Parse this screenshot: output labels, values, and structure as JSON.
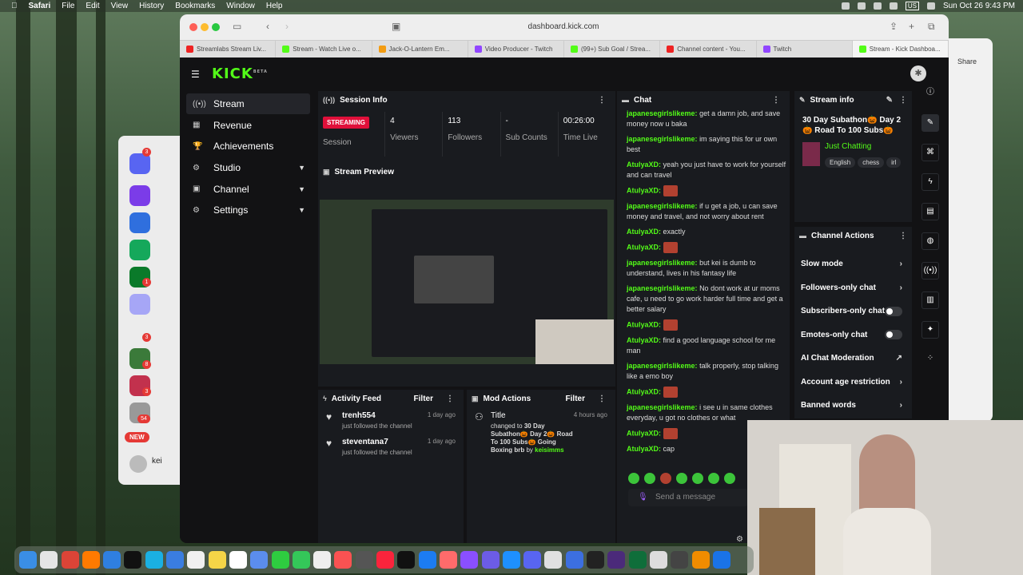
{
  "menubar": {
    "items": [
      "Safari",
      "File",
      "Edit",
      "View",
      "History",
      "Bookmarks",
      "Window",
      "Help"
    ],
    "clock": "Sun Oct 26  9:43 PM",
    "us_label": "US"
  },
  "browser": {
    "url": "dashboard.kick.com",
    "tabs": [
      "Streamlabs Stream Liv...",
      "Stream - Watch Live o...",
      "Jack-O-Lantern Em...",
      "Video Producer - Twitch",
      "(99+) Sub Goal / Strea...",
      "Channel content - You...",
      "Twitch",
      "Stream - Kick Dashboa..."
    ],
    "share_label": "Share"
  },
  "kick": {
    "logo": "KICK",
    "logo_sup": "BETA",
    "nav": [
      {
        "label": "Stream",
        "icon": "stream-icon"
      },
      {
        "label": "Revenue",
        "icon": "revenue-icon"
      },
      {
        "label": "Achievements",
        "icon": "trophy-icon"
      },
      {
        "label": "Studio",
        "icon": "gear-icon"
      },
      {
        "label": "Channel",
        "icon": "user-icon"
      },
      {
        "label": "Settings",
        "icon": "gear-icon"
      }
    ],
    "session": {
      "title": "Session Info",
      "status": "STREAMING",
      "status_label": "Session",
      "stats": [
        {
          "value": "4",
          "label": "Viewers"
        },
        {
          "value": "113",
          "label": "Followers"
        },
        {
          "value": "-",
          "label": "Sub Counts"
        },
        {
          "value": "00:26:00",
          "label": "Time Live"
        }
      ]
    },
    "preview": {
      "title": "Stream Preview"
    },
    "chat": {
      "title": "Chat",
      "send_placeholder": "Send a message",
      "messages": [
        {
          "user": "japanesegirlslikeme:",
          "text": "get a damn job, and save money now u baka"
        },
        {
          "user": "japanesegirlslikeme:",
          "text": "im saying this for ur own best"
        },
        {
          "user": "AtulyaXD:",
          "text": "yeah you just have to work for yourself and can travel"
        },
        {
          "user": "AtulyaXD:",
          "text": "",
          "emote": true
        },
        {
          "user": "japanesegirlslikeme:",
          "text": "if u get a job, u can save money and travel, and not worry about rent"
        },
        {
          "user": "AtulyaXD:",
          "text": "exactly"
        },
        {
          "user": "AtulyaXD:",
          "text": "",
          "emote": true
        },
        {
          "user": "japanesegirlslikeme:",
          "text": "but kei is dumb to understand, lives in his fantasy life"
        },
        {
          "user": "japanesegirlslikeme:",
          "text": "No dont work at ur moms cafe, u need to go work harder full time and get a better salary"
        },
        {
          "user": "AtulyaXD:",
          "text": "",
          "emote": true
        },
        {
          "user": "AtulyaXD:",
          "text": "find a good language school for me man"
        },
        {
          "user": "japanesegirlslikeme:",
          "text": "talk properly, stop talking like a emo boy"
        },
        {
          "user": "AtulyaXD:",
          "text": "",
          "emote": true
        },
        {
          "user": "japanesegirlslikeme:",
          "text": "i see u in same clothes everyday, u got no clothes or what"
        },
        {
          "user": "AtulyaXD:",
          "text": "",
          "emote": true
        },
        {
          "user": "AtulyaXD:",
          "text": "cap"
        }
      ]
    },
    "stream_info": {
      "title": "Stream info",
      "stream_title": "30 Day Subathon🎃 Day 2 🎃 Road To 100 Subs🎃",
      "category": "Just Chatting",
      "tags": [
        "English",
        "chess",
        "irl"
      ]
    },
    "channel_actions": {
      "title": "Channel Actions",
      "items": [
        {
          "label": "Slow mode",
          "control": "arrow"
        },
        {
          "label": "Followers-only chat",
          "control": "arrow"
        },
        {
          "label": "Subscribers-only chat",
          "control": "toggle"
        },
        {
          "label": "Emotes-only chat",
          "control": "toggle"
        },
        {
          "label": "AI Chat Moderation",
          "control": "link"
        },
        {
          "label": "Account age restriction",
          "control": "arrow"
        },
        {
          "label": "Banned words",
          "control": "arrow"
        }
      ]
    },
    "activity": {
      "title": "Activity Feed",
      "filter": "Filter",
      "items": [
        {
          "user": "trenh554",
          "action": "just followed the channel",
          "time": "1 day ago"
        },
        {
          "user": "steventana7",
          "action": "just followed the channel",
          "time": "1 day ago"
        }
      ]
    },
    "mod": {
      "title": "Mod Actions",
      "filter": "Filter",
      "item": {
        "label": "Title",
        "time": "4 hours ago",
        "text": "changed to",
        "new_title": "30 Day Subathon🎃 Day 2🎃 Road To 100 Subs🎃 Going Boxing brb",
        "by": "by",
        "moderator": "keisimms"
      }
    }
  },
  "bg_app": {
    "new_badge": "NEW",
    "user": "kei",
    "badges": [
      "3",
      "1",
      "3",
      "8",
      "3",
      "54"
    ]
  }
}
